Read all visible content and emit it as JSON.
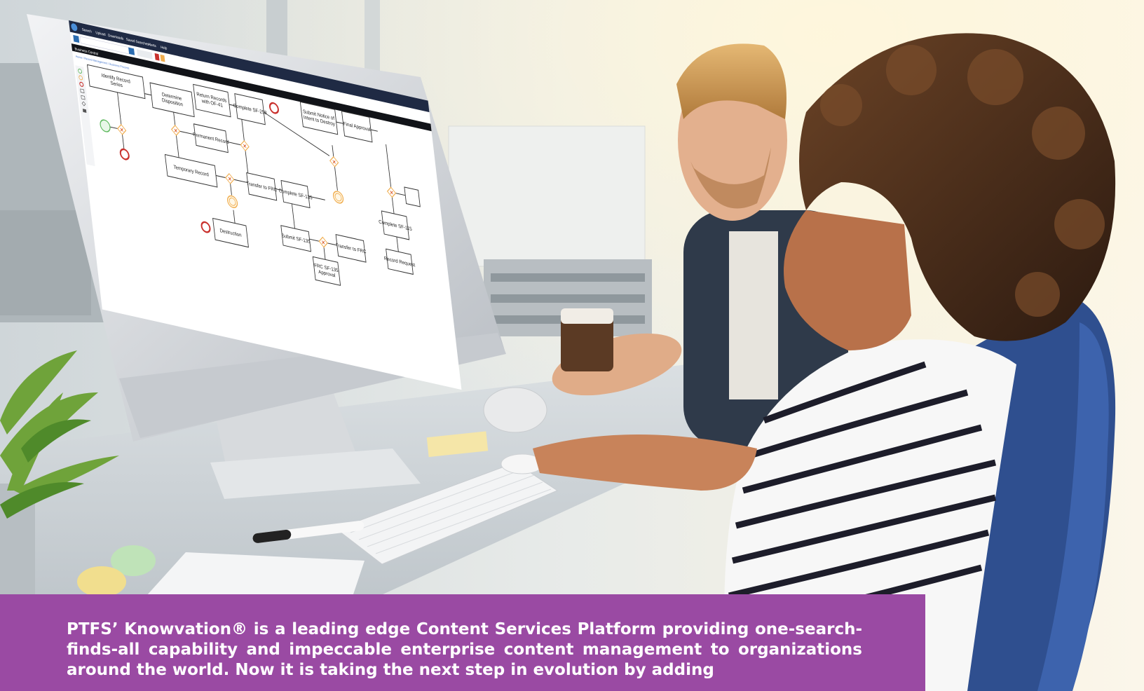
{
  "caption": {
    "text": "PTFS’ Knowvation® is a leading edge Content Services Platform providing one-search-finds-all capability and impeccable enterprise content management to organizations around the world. Now it is taking the next step in evolution by adding"
  },
  "screen_app": {
    "nav_items": [
      "Search",
      "Upload",
      "Downloads",
      "Saved Searches",
      "Alerts",
      "Help"
    ],
    "brand_bar_title": "Business Central",
    "breadcrumb": "Home / Record Management / Business Process"
  },
  "diagram": {
    "nodes": {
      "identify": [
        "Identify Record",
        "Series"
      ],
      "determine": [
        "Determine",
        "Disposition"
      ],
      "return": [
        "Return Records",
        "with OF-41"
      ],
      "complete258": [
        "Complete SF-258"
      ],
      "submit_notice": [
        "Submit Notice of",
        "Intent to Destroy"
      ],
      "final": [
        "Final Approval"
      ],
      "permanent": [
        "Permanent Record"
      ],
      "temporary": [
        "Temporary Record"
      ],
      "transfer_frc": [
        "Transfer to FRC"
      ],
      "complete135": [
        "Complete SF-135"
      ],
      "submit135": [
        "Submit SF-135"
      ],
      "transfer_frc2": [
        "Transfer to FRC"
      ],
      "frc_approval": [
        "FRC SF-135",
        "Approval"
      ],
      "destruction": [
        "Destruction"
      ],
      "complete115": [
        "Complete SF-115"
      ],
      "records_request": [
        "Record Request"
      ]
    }
  },
  "colors": {
    "caption_bg": "#9a4aa3",
    "start_event": "#5cb85c",
    "end_event": "#c9302c",
    "gateway": "#f0ad4e",
    "gateway_marker": "#d9531e"
  }
}
